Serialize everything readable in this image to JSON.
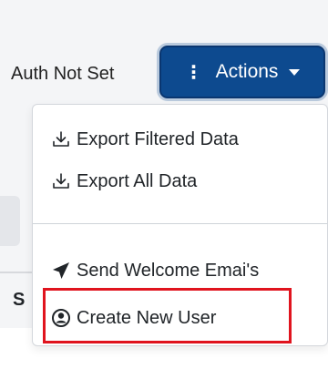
{
  "header": {
    "auth_status": "Auth Not Set",
    "actions_button": {
      "label": "Actions",
      "kebab": "⋮"
    }
  },
  "background": {
    "column_letter": "S"
  },
  "menu": {
    "items": [
      {
        "label": "Export Filtered Data",
        "icon": "download-icon"
      },
      {
        "label": "Export All Data",
        "icon": "download-icon"
      },
      {
        "label": "Send Welcome Emai's",
        "icon": "paper-plane-icon"
      },
      {
        "label": "Create New User",
        "icon": "user-circle-icon"
      }
    ]
  },
  "colors": {
    "primary": "#0d4a8f",
    "highlight": "#e0141e"
  }
}
